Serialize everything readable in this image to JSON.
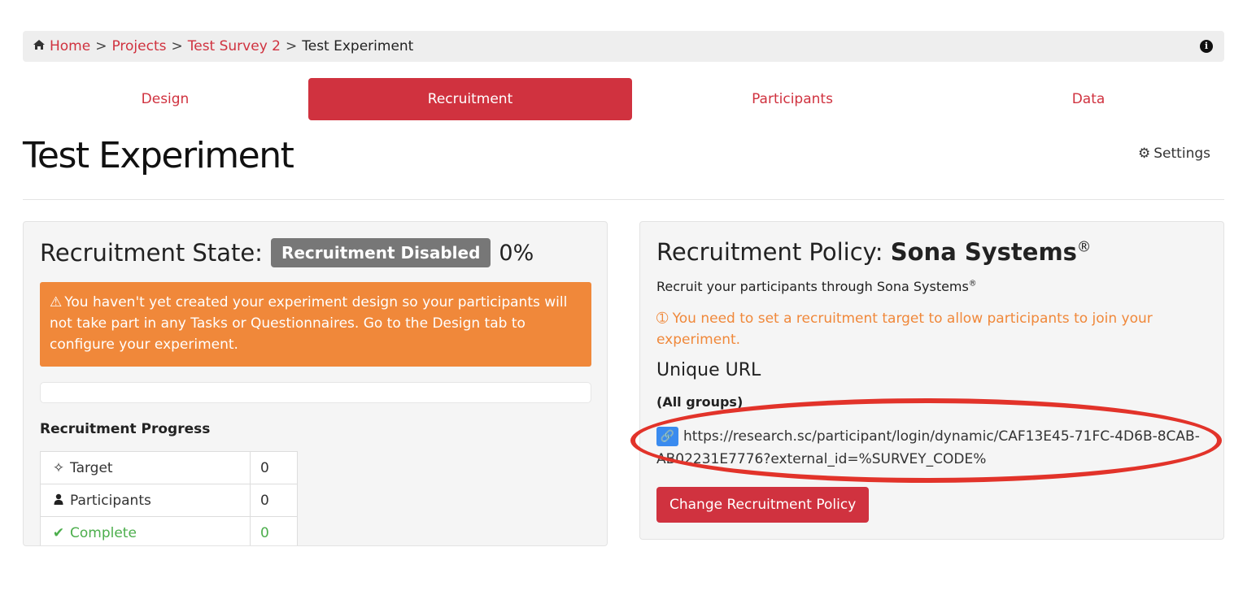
{
  "breadcrumb": {
    "home_icon": "home-icon",
    "home": "Home",
    "separator": ">",
    "projects": "Projects",
    "survey": "Test Survey 2",
    "current": "Test Experiment",
    "info_icon": "info-icon"
  },
  "tabs": [
    {
      "label": "Design",
      "active": false
    },
    {
      "label": "Recruitment",
      "active": true
    },
    {
      "label": "Participants",
      "active": false
    },
    {
      "label": "Data",
      "active": false
    }
  ],
  "page": {
    "title": "Test Experiment",
    "settings_label": "Settings",
    "settings_icon": "gear-icon"
  },
  "recruitment_state": {
    "title": "Recruitment State:",
    "badge": "Recruitment Disabled",
    "percent": "0%",
    "progress_fraction": 0,
    "warning_icon": "warning-icon",
    "warning": "You haven't yet created your experiment design so your participants will not take part in any Tasks or Questionnaires. Go to the Design tab to configure your experiment.",
    "progress_title": "Recruitment Progress",
    "rows": [
      {
        "icon": "crosshair-icon",
        "label": "Target",
        "value": "0"
      },
      {
        "icon": "user-icon",
        "label": "Participants",
        "value": "0"
      },
      {
        "icon": "check-icon",
        "label": "Complete",
        "value": "0"
      }
    ]
  },
  "policy": {
    "title": "Recruitment Policy:",
    "name": "Sona Systems",
    "registered": "®",
    "description": "Recruit your participants through Sona Systems",
    "note_icon": "info-circle-icon",
    "note": "You need to set a recruitment target to allow participants to join your experiment.",
    "url_heading": "Unique URL",
    "url_groups": "(All groups)",
    "link_icon": "link-icon",
    "url": "https://research.sc/participant/login/dynamic/CAF13E45-71FC-4D6B-8CAB-AB02231E7776?external_id=%SURVEY_CODE%",
    "change_button": "Change Recruitment Policy"
  },
  "colors": {
    "accent": "#d0323f",
    "warning": "#f0883a",
    "success": "#4cae4c",
    "badge": "#777777",
    "link_icon": "#3a8bef",
    "highlight": "#e2332a"
  }
}
